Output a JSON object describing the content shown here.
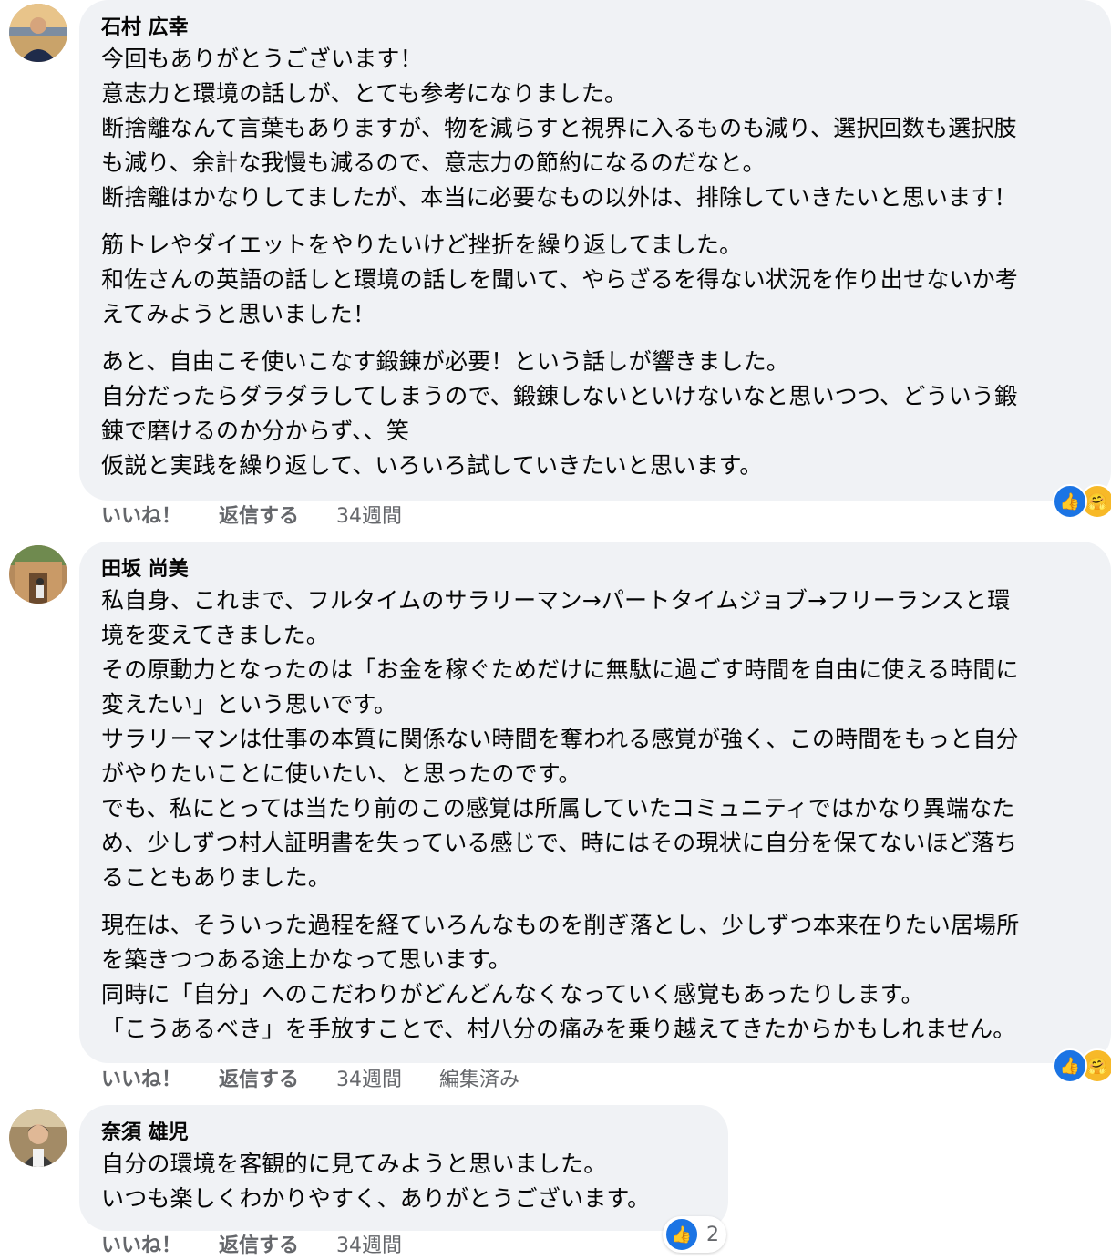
{
  "comments": [
    {
      "author": "石村 広幸",
      "paragraphs": [
        [
          "今回もありがとうございます！",
          "意志力と環境の話しが、とても参考になりました。",
          "断捨離なんて言葉もありますが、物を減らすと視界に入るものも減り、選択回数も選択肢",
          "も減り、余計な我慢も減るので、意志力の節約になるのだなと。",
          "断捨離はかなりしてましたが、本当に必要なもの以外は、排除していきたいと思います！"
        ],
        [
          "筋トレやダイエットをやりたいけど挫折を繰り返してました。",
          "和佐さんの英語の話しと環境の話しを聞いて、やらざるを得ない状況を作り出せないか考",
          "えてみようと思いました！"
        ],
        [
          "あと、自由こそ使いこなす鍛錬が必要！という話しが響きました。",
          "自分だったらダラダラしてしまうので、鍛錬しないといけないなと思いつつ、どういう鍛",
          "錬で磨けるのか分からず、、笑",
          "仮説と実践を繰り返して、いろいろ試していきたいと思います。"
        ]
      ],
      "like": "いいね！",
      "reply": "返信する",
      "time": "34週間",
      "edited": "",
      "reaction_count": ""
    },
    {
      "author": "田坂 尚美",
      "paragraphs": [
        [
          "私自身、これまで、フルタイムのサラリーマン→パートタイムジョブ→フリーランスと環",
          "境を変えてきました。",
          "その原動力となったのは「お金を稼ぐためだけに無駄に過ごす時間を自由に使える時間に",
          "変えたい」という思いです。",
          "サラリーマンは仕事の本質に関係ない時間を奪われる感覚が強く、この時間をもっと自分",
          "がやりたいことに使いたい、と思ったのです。",
          "でも、私にとっては当たり前のこの感覚は所属していたコミュニティではかなり異端なた",
          "め、少しずつ村人証明書を失っている感じで、時にはその現状に自分を保てないほど落ち",
          "ることもありました。"
        ],
        [
          "現在は、そういった過程を経ていろんなものを削ぎ落とし、少しずつ本来在りたい居場所",
          "を築きつつある途上かなって思います。",
          "同時に「自分」へのこだわりがどんどんなくなっていく感覚もあったりします。",
          "「こうあるべき」を手放すことで、村八分の痛みを乗り越えてきたからかもしれません。"
        ]
      ],
      "like": "いいね！",
      "reply": "返信する",
      "time": "34週間",
      "edited": "編集済み",
      "reaction_count": ""
    },
    {
      "author": "奈須 雄児",
      "paragraphs": [
        [
          "自分の環境を客観的に見てみようと思いました。",
          "いつも楽しくわかりやすく、ありがとうございます。"
        ]
      ],
      "like": "いいね！",
      "reply": "返信する",
      "time": "34週間",
      "edited": "",
      "reaction_count": "2"
    }
  ],
  "reaction_icons": [
    "like-icon",
    "care-icon"
  ],
  "colors": {
    "bubble": "#f0f2f5",
    "like_blue": "#1b74e4",
    "meta_gray": "#65676b"
  }
}
